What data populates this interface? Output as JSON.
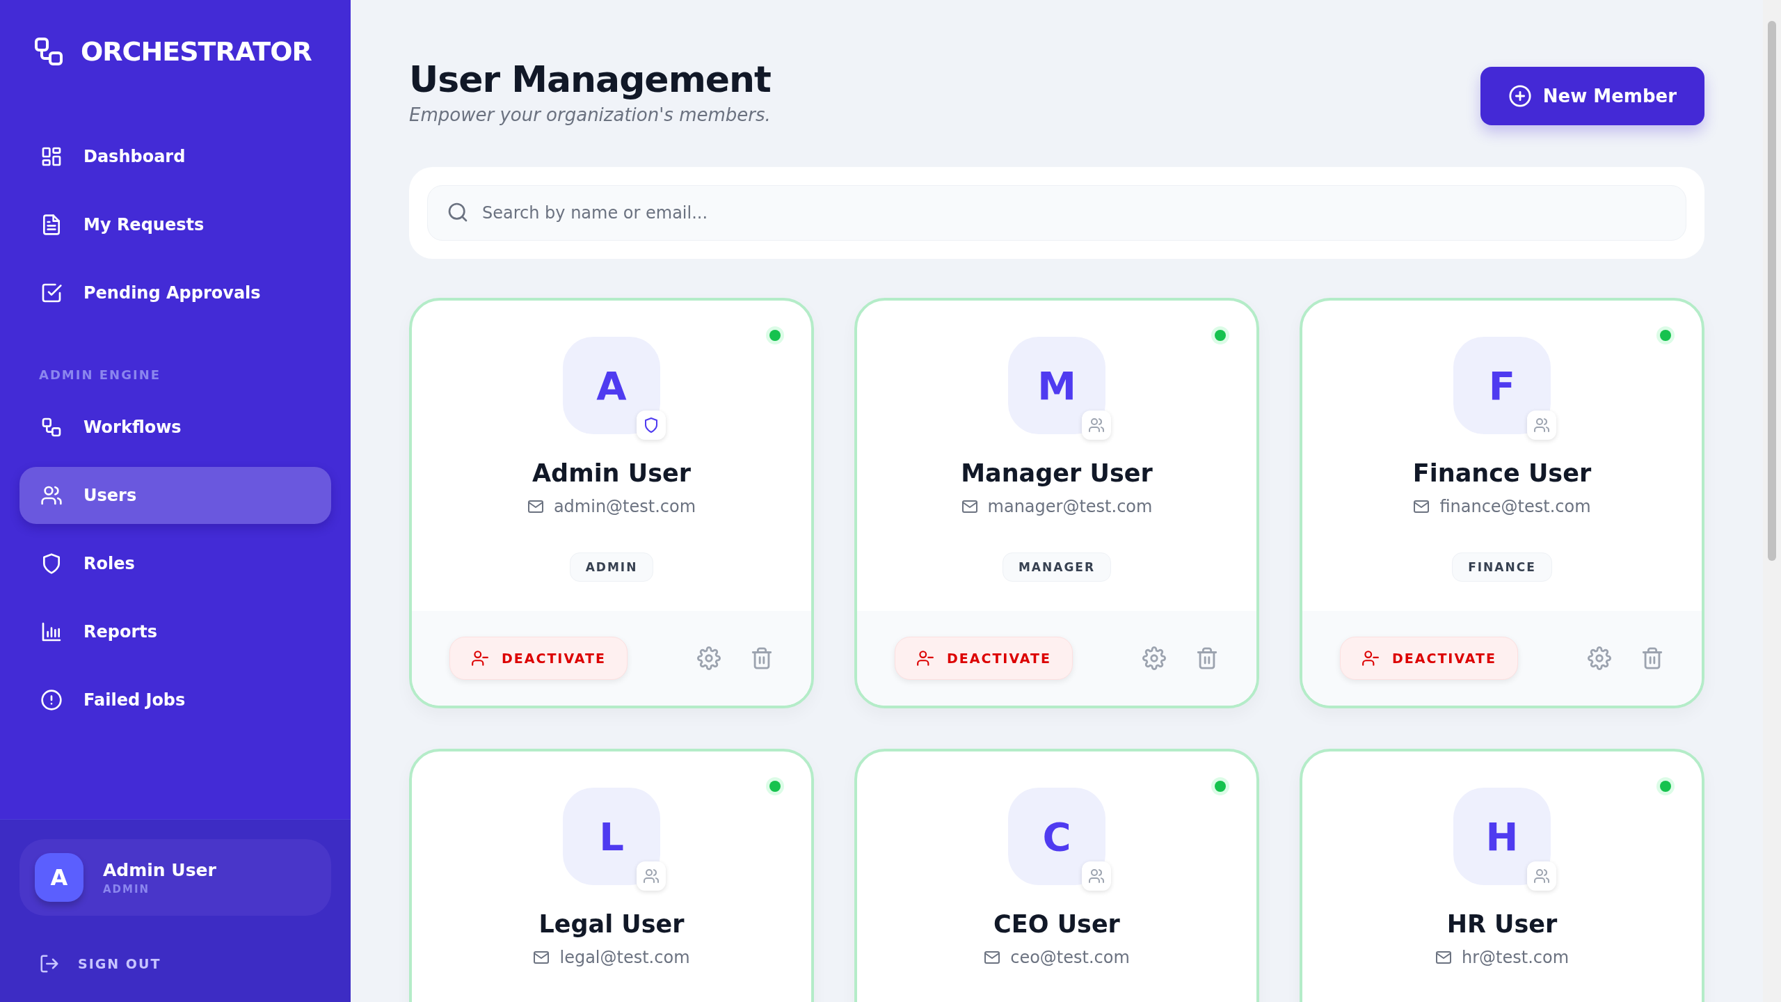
{
  "sidebar": {
    "logo": "ORCHESTRATOR",
    "items": [
      {
        "label": "Dashboard",
        "selected": false
      },
      {
        "label": "My Requests",
        "selected": false
      },
      {
        "label": "Pending Approvals",
        "selected": false
      }
    ],
    "section_label": "ADMIN ENGINE",
    "admin_items": [
      {
        "label": "Workflows",
        "selected": false
      },
      {
        "label": "Users",
        "selected": true
      },
      {
        "label": "Roles",
        "selected": false
      },
      {
        "label": "Reports",
        "selected": false
      },
      {
        "label": "Failed Jobs",
        "selected": false
      }
    ],
    "current_user": {
      "initial": "A",
      "name": "Admin User",
      "role": "ADMIN"
    },
    "sign_out": "SIGN OUT"
  },
  "header": {
    "title": "User Management",
    "subtitle": "Empower your organization's members.",
    "new_button": "New Member"
  },
  "search": {
    "placeholder": "Search by name or email..."
  },
  "users": [
    {
      "initial": "A",
      "name": "Admin User",
      "email": "admin@test.com",
      "role": "ADMIN",
      "kind": "admin",
      "active": true,
      "action": "DEACTIVATE"
    },
    {
      "initial": "M",
      "name": "Manager User",
      "email": "manager@test.com",
      "role": "MANAGER",
      "kind": "member",
      "active": true,
      "action": "DEACTIVATE"
    },
    {
      "initial": "F",
      "name": "Finance User",
      "email": "finance@test.com",
      "role": "FINANCE",
      "kind": "member",
      "active": true,
      "action": "DEACTIVATE"
    },
    {
      "initial": "L",
      "name": "Legal User",
      "email": "legal@test.com",
      "kind": "member",
      "active": true
    },
    {
      "initial": "C",
      "name": "CEO User",
      "email": "ceo@test.com",
      "kind": "member",
      "active": true
    },
    {
      "initial": "H",
      "name": "HR User",
      "email": "hr@test.com",
      "kind": "member",
      "active": true
    }
  ]
}
